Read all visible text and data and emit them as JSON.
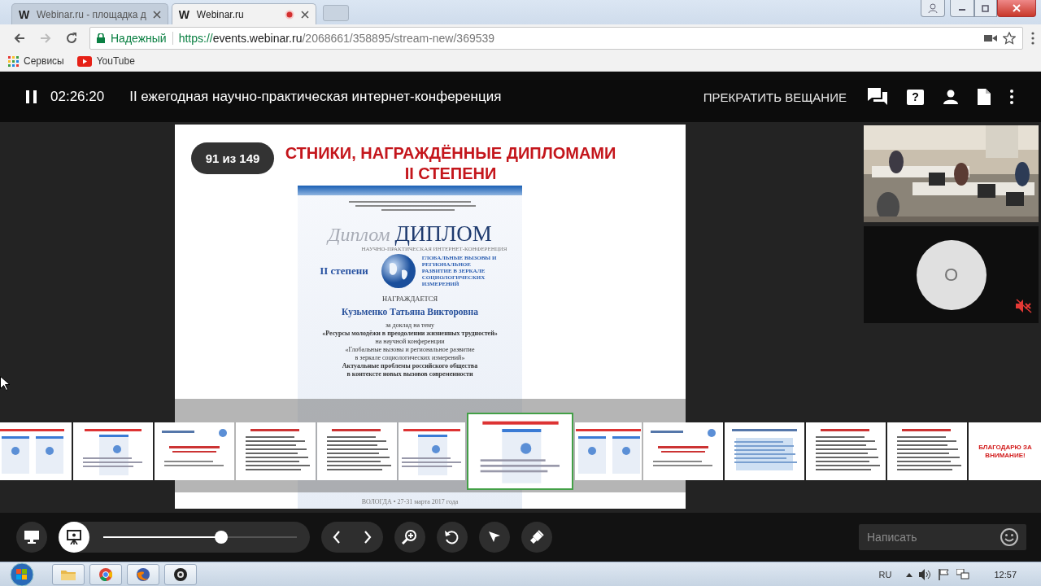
{
  "browser": {
    "tabs": [
      {
        "favicon": "W",
        "title": "Webinar.ru - площадка д",
        "selected": false,
        "recording": false
      },
      {
        "favicon": "W",
        "title": "Webinar.ru",
        "selected": true,
        "recording": true
      }
    ],
    "nav": {
      "back_enabled": true,
      "forward_enabled": false
    },
    "security_label": "Надежный",
    "url": {
      "scheme": "https://",
      "host": "events.webinar.ru",
      "path": "/2068661/358895/stream-new/369539"
    },
    "bookmarks": [
      {
        "kind": "apps",
        "label": "Сервисы"
      },
      {
        "kind": "video",
        "label": "YouTube"
      }
    ]
  },
  "header": {
    "playing": true,
    "time": "02:26:20",
    "title": "II ежегодная научно-практическая интернет-конференция",
    "stop_button": "ПРЕКРАТИТЬ ВЕЩАНИЕ",
    "help_glyph": "?"
  },
  "slide": {
    "counter": "91 из 149",
    "title_lines": [
      "СТНИКИ, НАГРАЖДЁННЫЕ ДИПЛОМАМИ",
      "II СТЕПЕНИ"
    ],
    "diploma": {
      "heading": "ДИПЛОМ",
      "script_heading": "Диплом",
      "subheading": "НАУЧНО-ПРАКТИЧЕСКАЯ ИНТЕРНЕТ-КОНФЕРЕНЦИЯ",
      "degree": "II степени",
      "conference_logo_text": "ГЛОБАЛЬНЫЕ ВЫЗОВЫ И РЕГИОНАЛЬНОЕ РАЗВИТИЕ В ЗЕРКАЛЕ СОЦИОЛОГИЧЕСКИХ ИЗМЕРЕНИЙ",
      "awarded": "НАГРАЖДАЕТСЯ",
      "recipient": "Кузьменко Татьяна Викторовна",
      "lines": [
        {
          "text": "за доклад на тему",
          "bold": false
        },
        {
          "text": "«Ресурсы молодёжи в преодолении жизненных трудностей»",
          "bold": true
        },
        {
          "text": "на научной конференции",
          "bold": false
        },
        {
          "text": "«Глобальные вызовы и региональное развитие",
          "bold": false
        },
        {
          "text": "в зеркале социологических измерений»",
          "bold": false
        },
        {
          "text": "Актуальные проблемы российского общества",
          "bold": true
        },
        {
          "text": "в контексте новых вызовов современности",
          "bold": true
        }
      ],
      "footer": "ВОЛОГДА • 27-31 марта 2017 года"
    }
  },
  "thumbnails": [
    {
      "kind": "diplomas",
      "selected": false
    },
    {
      "kind": "diploma",
      "selected": false
    },
    {
      "kind": "title",
      "selected": false
    },
    {
      "kind": "list",
      "selected": false
    },
    {
      "kind": "list",
      "selected": false
    },
    {
      "kind": "diploma",
      "selected": false
    },
    {
      "kind": "diploma",
      "selected": true
    },
    {
      "kind": "diplomas",
      "selected": false
    },
    {
      "kind": "title",
      "selected": false
    },
    {
      "kind": "table",
      "selected": false
    },
    {
      "kind": "list",
      "selected": false
    },
    {
      "kind": "list",
      "selected": false
    },
    {
      "kind": "thanks",
      "selected": false,
      "caption": "БЛАГОДАРЮ ЗА ВНИМАНИЕ!"
    }
  ],
  "participant": {
    "avatar_letter": "O",
    "muted": true
  },
  "controls": {
    "level": 0.61,
    "chat_placeholder": "Написать"
  },
  "taskbar": {
    "language": "RU",
    "clock": "12:57"
  }
}
